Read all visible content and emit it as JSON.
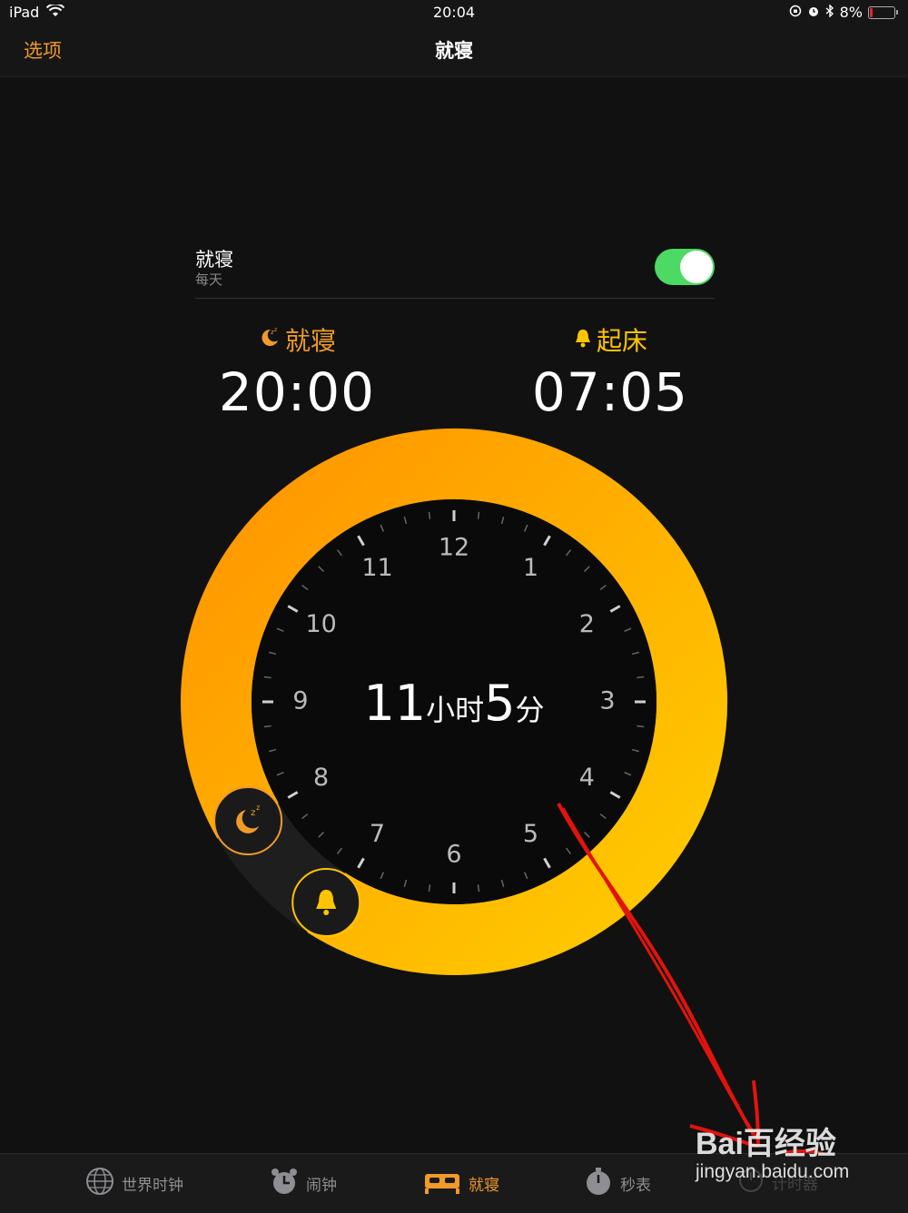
{
  "status_bar": {
    "device": "iPad",
    "time": "20:04",
    "battery": "8%"
  },
  "nav": {
    "left_label": "选项",
    "title": "就寝"
  },
  "schedule": {
    "title": "就寝",
    "subtitle": "每天",
    "enabled": true
  },
  "bedtime": {
    "label": "就寝",
    "time": "20:00"
  },
  "wake": {
    "label": "起床",
    "time": "07:05"
  },
  "duration": {
    "hours": "11",
    "hours_unit": "小时",
    "minutes": "5",
    "minutes_unit": "分"
  },
  "clock_numbers": [
    "12",
    "1",
    "2",
    "3",
    "4",
    "5",
    "6",
    "7",
    "8",
    "9",
    "10",
    "11"
  ],
  "tabs": [
    {
      "label": "世界时钟",
      "icon": "globe-icon"
    },
    {
      "label": "闹钟",
      "icon": "alarm-clock-icon"
    },
    {
      "label": "就寝",
      "icon": "bed-icon",
      "active": true
    },
    {
      "label": "秒表",
      "icon": "stopwatch-icon"
    },
    {
      "label": "计时器",
      "icon": "timer-icon"
    }
  ],
  "watermark": {
    "logo": "Bai百经验",
    "url": "jingyan.baidu.com"
  },
  "colors": {
    "accent": "#f09a29",
    "ring_start": "#ff9500",
    "ring_end": "#ffcc00",
    "toggle_on": "#4cd964"
  }
}
